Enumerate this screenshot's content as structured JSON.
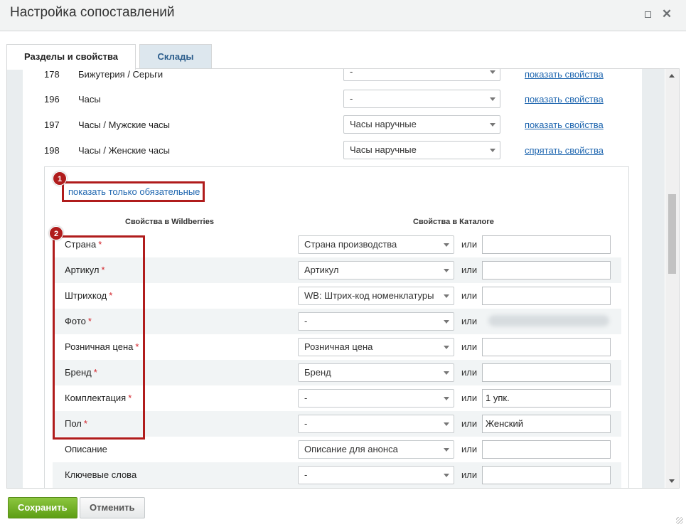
{
  "window": {
    "title": "Настройка сопоставлений"
  },
  "tabs": [
    {
      "label": "Разделы и свойства",
      "active": true
    },
    {
      "label": "Склады",
      "active": false
    }
  ],
  "categories": [
    {
      "id": "178",
      "name": "Бижутерия / Серьги",
      "select": "-",
      "link": "показать свойства"
    },
    {
      "id": "196",
      "name": "Часы",
      "select": "-",
      "link": "показать свойства"
    },
    {
      "id": "197",
      "name": "Часы / Мужские часы",
      "select": "Часы наручные",
      "link": "показать свойства"
    },
    {
      "id": "198",
      "name": "Часы / Женские часы",
      "select": "Часы наручные",
      "link": "спрятать свойства"
    }
  ],
  "properties": {
    "show_required_link": "показать только обязательные",
    "col_wb": "Свойства в Wildberries",
    "col_catalog": "Свойства в Каталоге",
    "or_label": "или",
    "required_mark": "*",
    "rows": [
      {
        "name": "Страна",
        "required": true,
        "select": "Страна производства",
        "value": ""
      },
      {
        "name": "Артикул",
        "required": true,
        "select": "Артикул",
        "value": ""
      },
      {
        "name": "Штрихкод",
        "required": true,
        "select": "WB: Штрих-код номенклатуры",
        "value": ""
      },
      {
        "name": "Фото",
        "required": true,
        "select": "-",
        "value": ""
      },
      {
        "name": "Розничная цена",
        "required": true,
        "select": "Розничная цена",
        "value": ""
      },
      {
        "name": "Бренд",
        "required": true,
        "select": "Бренд",
        "value": ""
      },
      {
        "name": "Комплектация",
        "required": true,
        "select": "-",
        "value": "1 упк."
      },
      {
        "name": "Пол",
        "required": true,
        "select": "-",
        "value": "Женский"
      },
      {
        "name": "Описание",
        "required": false,
        "select": "Описание для анонса",
        "value": ""
      },
      {
        "name": "Ключевые слова",
        "required": false,
        "select": "-",
        "value": ""
      }
    ]
  },
  "annotations": {
    "badge1": "1",
    "badge2": "2",
    "color": "#b01c1c"
  },
  "footer": {
    "save_label": "Сохранить",
    "cancel_label": "Отменить"
  },
  "colors": {
    "accent_link": "#2067b0",
    "save_button": "#6aab1f",
    "required": "#d2232a"
  }
}
